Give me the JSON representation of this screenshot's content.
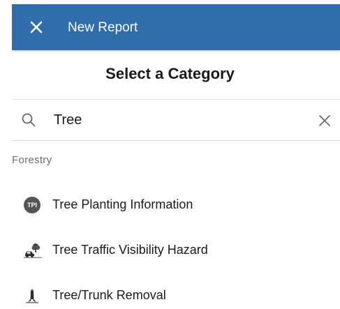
{
  "header": {
    "title": "New Report",
    "close_icon": "close-icon"
  },
  "page_heading": "Select a Category",
  "search": {
    "value": "Tree",
    "search_icon": "search-icon",
    "clear_icon": "clear-icon"
  },
  "section": {
    "label": "Forestry"
  },
  "items": [
    {
      "label": "Tree Planting Information",
      "icon": "tpi-badge-icon",
      "badge_text": "TPI"
    },
    {
      "label": "Tree Traffic Visibility Hazard",
      "icon": "tree-traffic-hazard-icon"
    },
    {
      "label": "Tree/Trunk Removal",
      "icon": "tree-removal-icon"
    }
  ],
  "colors": {
    "header_bg": "#2f6eab",
    "text": "#1a1a1a",
    "muted_text": "#6e6e6e",
    "badge_bg": "#555555"
  }
}
